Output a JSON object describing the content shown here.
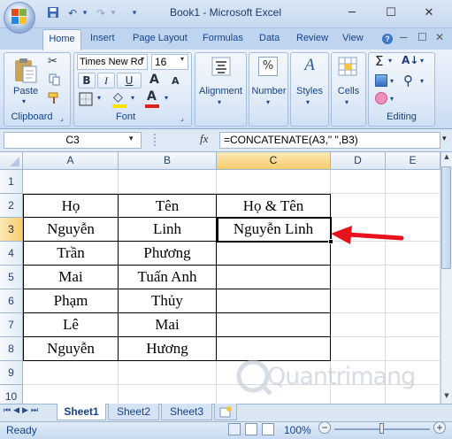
{
  "window": {
    "title": "Book1 - Microsoft Excel",
    "minimize": "─",
    "maximize": "☐",
    "close": "✕"
  },
  "qat": {
    "save": "save-icon",
    "undo": "↶",
    "redo": "↷",
    "more": "▾"
  },
  "tabs": [
    "Home",
    "Insert",
    "Page Layout",
    "Formulas",
    "Data",
    "Review",
    "View"
  ],
  "ribbon": {
    "clipboard": {
      "label": "Clipboard",
      "paste": "Paste"
    },
    "font": {
      "label": "Font",
      "family": "Times New Ro",
      "size": "16",
      "bold": "B",
      "italic": "I",
      "underline": "U",
      "grow": "A",
      "shrink": "A",
      "fill": "◇",
      "color": "A"
    },
    "alignment": "Alignment",
    "number": "Number",
    "number_sign": "%",
    "styles": "Styles",
    "styles_sign": "A",
    "cells": "Cells",
    "editing": {
      "label": "Editing",
      "sum": "Σ",
      "sort": "A↓",
      "find": "⚲"
    },
    "colors": {
      "font_color": "#e02020",
      "fill_color": "#ffe400"
    }
  },
  "formula_bar": {
    "name_box": "C3",
    "fx": "fx",
    "formula": "=CONCATENATE(A3,\" \",B3)"
  },
  "columns": [
    "A",
    "B",
    "C",
    "D",
    "E"
  ],
  "rows": [
    "1",
    "2",
    "3",
    "4",
    "5",
    "6",
    "7",
    "8",
    "9",
    "10"
  ],
  "cells": {
    "r2": [
      "Họ",
      "Tên",
      "Họ & Tên"
    ],
    "r3": [
      "Nguyễn",
      "Linh",
      "Nguyễn  Linh"
    ],
    "r4": [
      "Trần",
      "Phương",
      ""
    ],
    "r5": [
      "Mai",
      "Tuấn Anh",
      ""
    ],
    "r6": [
      "Phạm",
      "Thủy",
      ""
    ],
    "r7": [
      "Lê",
      "Mai",
      ""
    ],
    "r8": [
      "Nguyễn",
      "Hương",
      ""
    ]
  },
  "sheets": [
    "Sheet1",
    "Sheet2",
    "Sheet3"
  ],
  "status": {
    "ready": "Ready",
    "zoom": "100%",
    "minus": "−",
    "plus": "+"
  },
  "watermark": "Quantrimang",
  "annotation_color": "#e8121f"
}
